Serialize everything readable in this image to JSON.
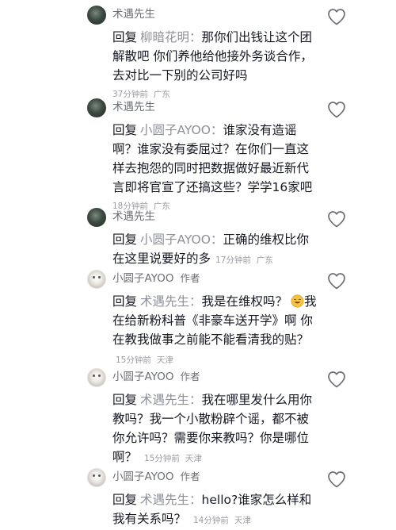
{
  "comments": [
    {
      "username": "术遇先生",
      "author_badge": "",
      "reply_word": "回复",
      "reply_target": "柳暗花明：",
      "text": "那你们出钱让这个团解散吧 你们养他给他接外务谈合作，去对比一下别的公司好吗",
      "time": "37分钟前",
      "location": "广东"
    },
    {
      "username": "术遇先生",
      "author_badge": "",
      "reply_word": "回复",
      "reply_target": "小圆子AYOO：",
      "text": "谁家没有造谣啊？谁家没有委屈过？在你们一直这样去抱怨的同时把数据做好最近新代言即将官宣了还搞这些？学学16家吧",
      "time": "18分钟前",
      "location": "广东"
    },
    {
      "username": "术遇先生",
      "author_badge": "",
      "reply_word": "回复",
      "reply_target": "小圆子AYOO：",
      "text": "正确的维权比你在这里说要好的多",
      "time": "17分钟前",
      "location": "广东"
    },
    {
      "username": "小圆子AYOO",
      "author_badge": "作者",
      "reply_word": "回复",
      "reply_target": "术遇先生：",
      "text": "我是在维权吗？",
      "text2": "我在给新粉科普《非豪车送开学》啊 你在教我做事之前能不能看清我的贴？",
      "emoji": "grinning-sweat-emoji",
      "time": "15分钟前",
      "location": "天津"
    },
    {
      "username": "小圆子AYOO",
      "author_badge": "作者",
      "reply_word": "回复",
      "reply_target": "术遇先生：",
      "text": "我在哪里发什么用你教吗？我一个小散粉辟个谣，都不被你允许吗？需要你来教吗？你是哪位啊？",
      "time": "15分钟前",
      "location": "天津"
    },
    {
      "username": "小圆子AYOO",
      "author_badge": "作者",
      "reply_word": "回复",
      "reply_target": "术遇先生：",
      "text": "hello?谁家怎么样和我有关系吗？",
      "time": "14分钟前",
      "location": "天津"
    }
  ],
  "icons": {
    "like": "heart-outline-icon",
    "avatar_dark": "dark-avatar",
    "avatar_light": "white-bear-avatar"
  },
  "colors": {
    "text": "#161823",
    "secondary": "#8e9099",
    "meta": "#9b9ba3"
  }
}
